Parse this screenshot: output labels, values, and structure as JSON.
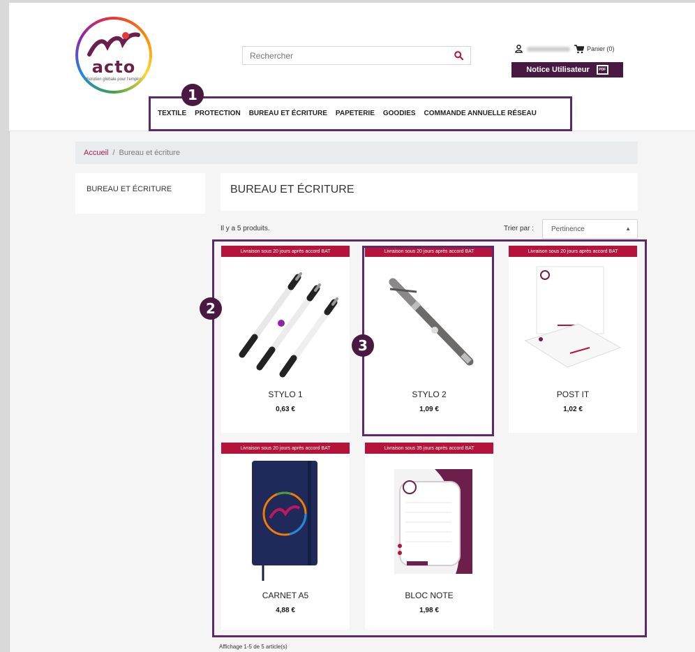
{
  "header": {
    "logo": {
      "word": "acto",
      "tagline": "Solution globale pour l'emploi"
    },
    "search": {
      "placeholder": "Rechercher"
    },
    "user": {
      "cart_label": "Panier (0)"
    },
    "notice_button": {
      "label": "Notice Utilisateur",
      "icon_text": "PDF"
    }
  },
  "nav": {
    "items": [
      "TEXTILE",
      "PROTECTION",
      "BUREAU ET ÉCRITURE",
      "PAPETERIE",
      "GOODIES",
      "COMMANDE ANNUELLE RÉSEAU"
    ]
  },
  "badges": [
    "1",
    "2",
    "3"
  ],
  "breadcrumb": {
    "home": "Accueil",
    "separator": "/",
    "current": "Bureau et écriture"
  },
  "sidebar": {
    "category": "BUREAU ET ÉCRITURE"
  },
  "category": {
    "title": "BUREAU ET ÉCRITURE",
    "count": "Il y a 5 produits.",
    "sort_label": "Trier par :",
    "sort_value": "Pertinence",
    "pagination": "Affichage 1-5 de 5 article(s)"
  },
  "products": [
    {
      "ribbon": "Livraison sous 20 jours après accord BAT",
      "name": "STYLO 1",
      "price": "0,63 €"
    },
    {
      "ribbon": "Livraison sous 20 jours après accord BAT",
      "name": "STYLO 2",
      "price": "1,09 €"
    },
    {
      "ribbon": "Livraison sous 20 jours après accord BAT",
      "name": "POST IT",
      "price": "1,02 €"
    },
    {
      "ribbon": "Livraison sous 20 jours après accord BAT",
      "name": "CARNET A5",
      "price": "4,88 €"
    },
    {
      "ribbon": "Livraison sous 35 jours après accord BAT",
      "name": "BLOC NOTE",
      "price": "1,98 €"
    }
  ],
  "colors": {
    "brand": "#4a1942",
    "ribbon": "#b5133a",
    "annotation": "#5b2a68",
    "link": "#a31d48"
  }
}
